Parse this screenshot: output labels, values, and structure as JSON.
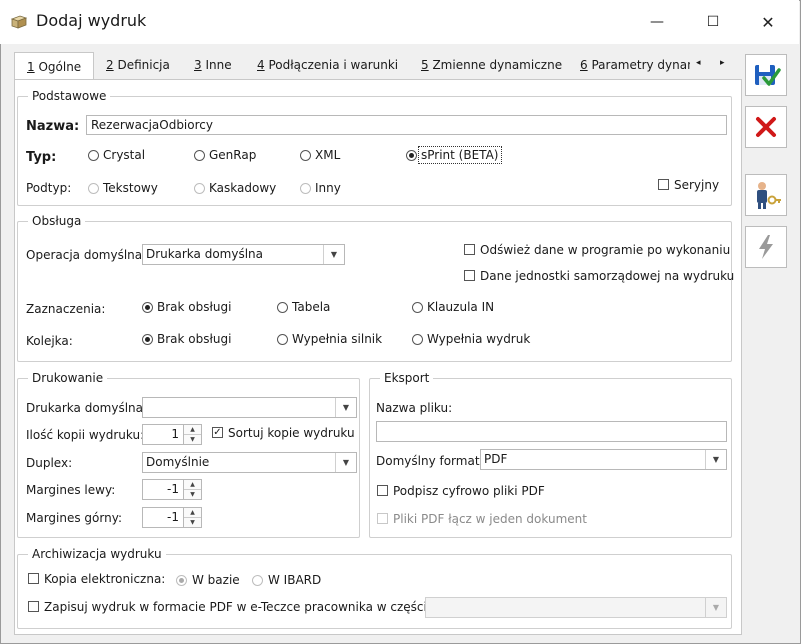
{
  "window": {
    "title": "Dodaj wydruk",
    "minimize": "—",
    "maximize": "☐",
    "close": "✕"
  },
  "tabs": [
    {
      "num": "1",
      "label": " Ogólne"
    },
    {
      "num": "2",
      "label": " Definicja"
    },
    {
      "num": "3",
      "label": " Inne"
    },
    {
      "num": "4",
      "label": " Podłączenia i warunki"
    },
    {
      "num": "5",
      "label": " Zmienne dynamiczne"
    },
    {
      "num": "6",
      "label": " Parametry dynan"
    }
  ],
  "tab_scroll": {
    "left": "◂",
    "right": "▸"
  },
  "podstawowe": {
    "title": "Podstawowe",
    "nazwa_label": "Nazwa:",
    "nazwa_value": "RezerwacjaOdbiorcy",
    "typ_label": "Typ:",
    "typ_options": [
      "Crystal",
      "GenRap",
      "XML",
      "sPrint (BETA)"
    ],
    "podtyp_label": "Podtyp:",
    "podtyp_options": [
      "Tekstowy",
      "Kaskadowy",
      "Inny"
    ],
    "seryjny_label": "Seryjny"
  },
  "obsluga": {
    "title": "Obsługa",
    "operacja_label": "Operacja domyślna:",
    "operacja_value": "Drukarka domyślna",
    "odswiez_label": "Odśwież dane w programie po wykonaniu",
    "dane_jst_label": "Dane jednostki samorządowej na wydruku",
    "zaznaczenia_label": "Zaznaczenia:",
    "zaznaczenia_options": [
      "Brak obsługi",
      "Tabela",
      "Klauzula IN"
    ],
    "kolejka_label": "Kolejka:",
    "kolejka_options": [
      "Brak obsługi",
      "Wypełnia silnik",
      "Wypełnia wydruk"
    ]
  },
  "drukowanie": {
    "title": "Drukowanie",
    "drukarka_label": "Drukarka domyślna:",
    "drukarka_value": "",
    "kopie_label": "Ilość kopii wydruku:",
    "kopie_value": "1",
    "sortuj_label": "Sortuj kopie wydruku",
    "duplex_label": "Duplex:",
    "duplex_value": "Domyślnie",
    "margin_left_label": "Margines lewy:",
    "margin_left_value": "-1",
    "margin_top_label": "Margines górny:",
    "margin_top_value": "-1"
  },
  "eksport": {
    "title": "Eksport",
    "nazwa_pliku_label": "Nazwa pliku:",
    "nazwa_pliku_value": "",
    "format_label": "Domyślny format:",
    "format_value": "PDF",
    "podpisz_label": "Podpisz cyfrowo pliki PDF",
    "laczenie_label": "Pliki PDF łącz w jeden dokument"
  },
  "archiwizacja": {
    "title": "Archiwizacja wydruku",
    "kopia_label": "Kopia elektroniczna:",
    "w_bazie_label": "W bazie",
    "w_ibard_label": "W IBARD",
    "zapisuj_label": "Zapisuj wydruk w formacie PDF w e-Teczce pracownika w części",
    "zapisuj_value": ""
  },
  "colors": {
    "save_blue": "#1f5fbf",
    "save_green": "#2a9a3a",
    "cancel_red": "#d01818"
  }
}
